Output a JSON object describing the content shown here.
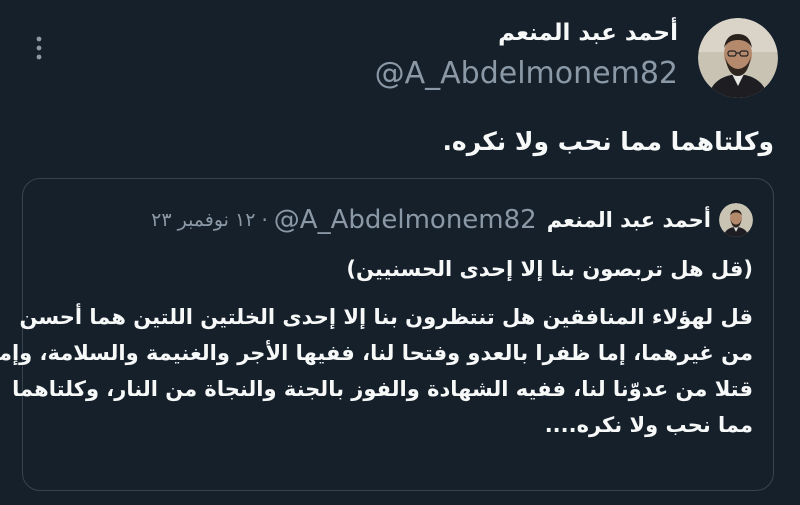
{
  "tweet": {
    "author_name": "أحمد عبد المنعم",
    "author_handle": "@A_Abdelmonem82",
    "text": "وكلتاهما مما نحب ولا نكره."
  },
  "quote": {
    "author_name": "أحمد عبد المنعم",
    "author_handle": "@A_Abdelmonem82",
    "separator": "·",
    "date": "١٢ نوفمبر ٢٣",
    "title": "(قل هل تربصون بنا إلا إحدى الحسنيين)",
    "lines": [
      "قل لهؤلاء المنافقين هل تنتظرون بنا إلا إحدى الخلتين اللتين هما أحسن",
      "من غيرهما، إما ظفرا بالعدو وفتحا لنا، ففيها الأجر والغنيمة والسلامة، وإما",
      "قتلا من عدوّنا لنا، ففيه الشهادة والفوز بالجنة والنجاة من النار، وكلتاهما",
      "مما نحب ولا نكره...."
    ]
  },
  "icons": {
    "more": "more-vertical-icon"
  },
  "colors": {
    "background": "#15202b",
    "text_primary": "#f7f9f9",
    "text_secondary": "#8b98a5",
    "border": "#38444d"
  }
}
